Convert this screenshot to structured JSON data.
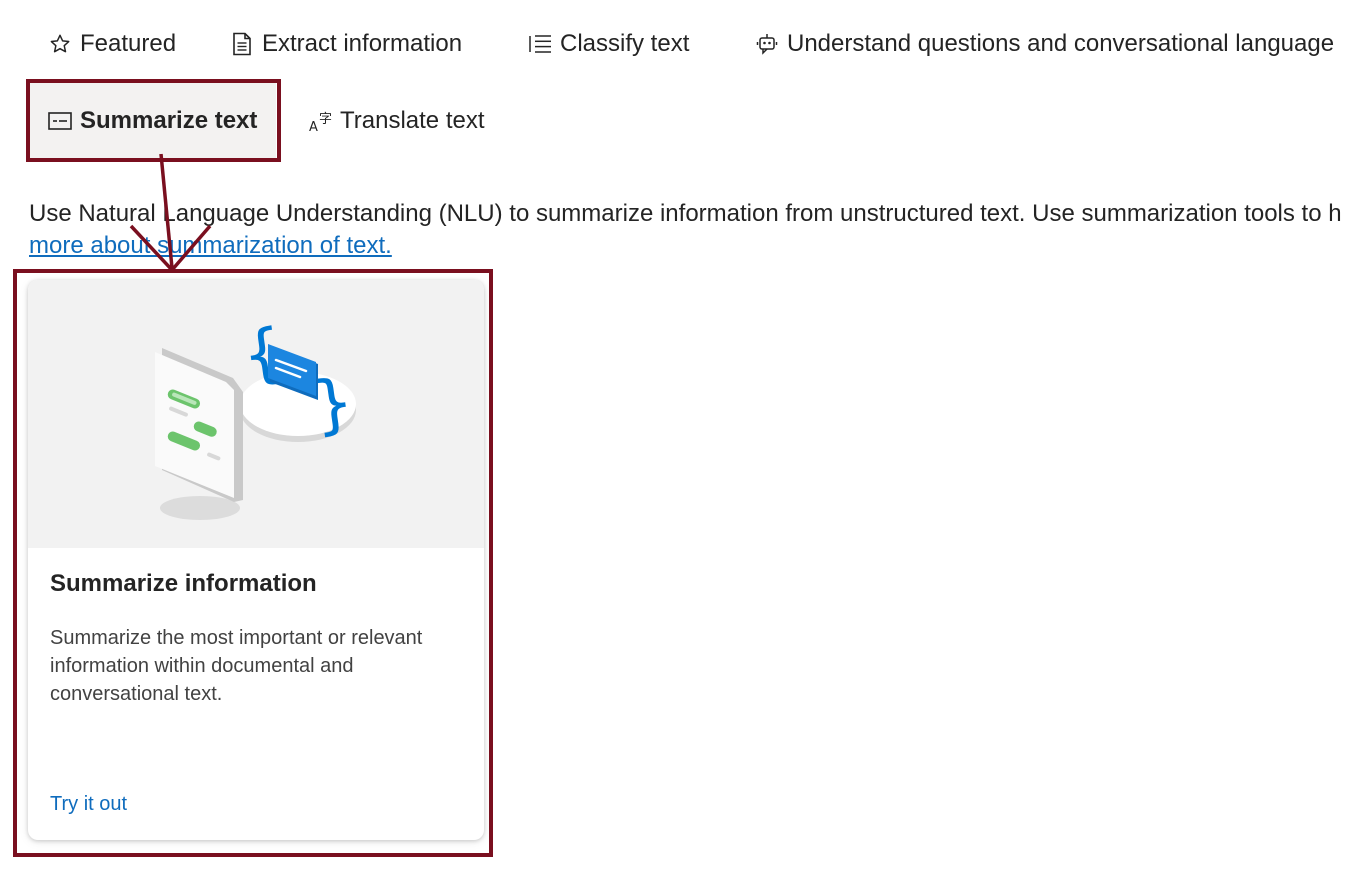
{
  "tabs": {
    "featured": {
      "label": "Featured",
      "icon": "star-icon"
    },
    "extract": {
      "label": "Extract information",
      "icon": "document-icon"
    },
    "classify": {
      "label": "Classify text",
      "icon": "list-icon"
    },
    "understand": {
      "label": "Understand questions and conversational language",
      "icon": "bot-icon"
    },
    "summarize": {
      "label": "Summarize text",
      "icon": "summary-icon",
      "selected": true
    },
    "translate": {
      "label": "Translate text",
      "icon": "translate-icon"
    }
  },
  "description": {
    "text": "Use Natural Language Understanding (NLU) to summarize information from unstructured text. Use summarization tools to h",
    "link_text": "more about summarization of text."
  },
  "card": {
    "title": "Summarize information",
    "text": "Summarize the most important or relevant information within documental and conversational text.",
    "link": "Try it out"
  },
  "colors": {
    "highlight": "#7a0f1f",
    "link": "#0f6cbd",
    "accent_blue": "#0078d4",
    "accent_green": "#6cc46c"
  }
}
